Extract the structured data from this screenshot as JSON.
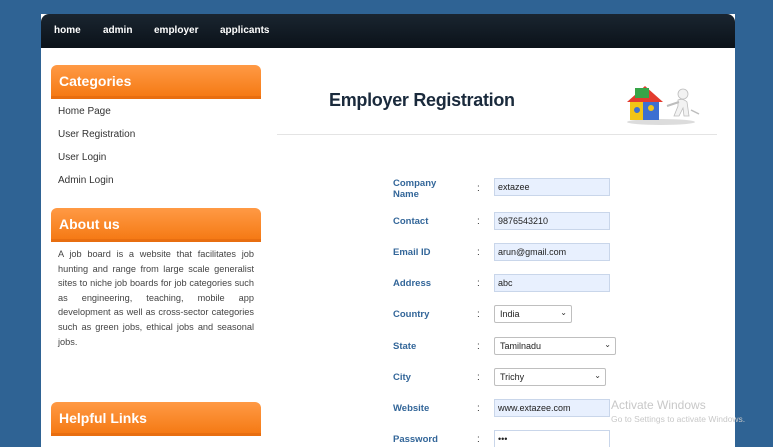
{
  "nav": {
    "items": [
      "home",
      "admin",
      "employer",
      "applicants"
    ]
  },
  "sidebar": {
    "categories_title": "Categories",
    "links": [
      "Home Page",
      "User Registration",
      "User Login",
      "Admin Login"
    ],
    "about_title": "About us",
    "about_text": "A job board is a website that facilitates job hunting and range from large scale generalist sites to niche job boards for job categories such as engineering, teaching, mobile app development as well as cross-sector categories such as green jobs, ethical jobs and seasonal jobs.",
    "helpful_title": "Helpful Links"
  },
  "main": {
    "title": "Employer Registration",
    "logo_icon": "puzzle-house-icon"
  },
  "form": {
    "company_label": "Company Name",
    "company_value": "extazee",
    "contact_label": "Contact",
    "contact_value": "9876543210",
    "email_label": "Email ID",
    "email_value": "arun@gmail.com",
    "address_label": "Address",
    "address_value": "abc",
    "country_label": "Country",
    "country_value": "India",
    "state_label": "State",
    "state_value": "Tamilnadu",
    "city_label": "City",
    "city_value": "Trichy",
    "website_label": "Website",
    "website_value": "www.extazee.com",
    "password_label": "Password",
    "password_value": "•••",
    "colon": ":"
  },
  "watermark": {
    "line1": "Activate Windows",
    "line2": "Go to Settings to activate Windows."
  },
  "colors": {
    "page_bg": "#2f6394",
    "nav_bg": "#0b1219",
    "accent_orange": "#f57a15",
    "label_blue": "#336699"
  }
}
